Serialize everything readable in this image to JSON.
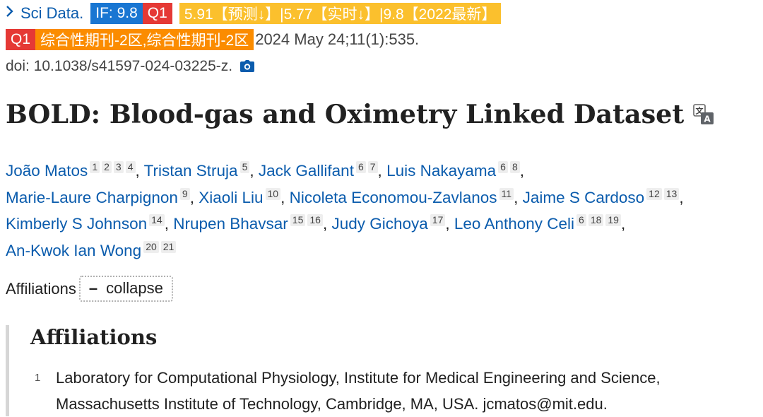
{
  "citation": {
    "journal": "Sci Data.",
    "if_badge": "IF: 9.8",
    "quartile": "Q1",
    "prediction": "5.91【预测↓】|5.77【实时↓】|9.8【2022最新】",
    "cas_quartile": "Q1",
    "category": "综合性期刊-2区,综合性期刊-2区",
    "pub_date": "2024 May 24;11(1):535.",
    "doi": "doi: 10.1038/s41597-024-03225-z."
  },
  "title": "BOLD: Blood-gas and Oximetry Linked Dataset",
  "authors": [
    {
      "name": "João Matos",
      "affs": [
        "1",
        "2",
        "3",
        "4"
      ]
    },
    {
      "name": "Tristan Struja",
      "affs": [
        "5"
      ]
    },
    {
      "name": "Jack Gallifant",
      "affs": [
        "6",
        "7"
      ]
    },
    {
      "name": "Luis Nakayama",
      "affs": [
        "6",
        "8"
      ]
    },
    {
      "name": "Marie-Laure Charpignon",
      "affs": [
        "9"
      ]
    },
    {
      "name": "Xiaoli Liu",
      "affs": [
        "10"
      ]
    },
    {
      "name": "Nicoleta Economou-Zavlanos",
      "affs": [
        "11"
      ]
    },
    {
      "name": "Jaime S Cardoso",
      "affs": [
        "12",
        "13"
      ]
    },
    {
      "name": "Kimberly S Johnson",
      "affs": [
        "14"
      ]
    },
    {
      "name": "Nrupen Bhavsar",
      "affs": [
        "15",
        "16"
      ]
    },
    {
      "name": "Judy Gichoya",
      "affs": [
        "17"
      ]
    },
    {
      "name": "Leo Anthony Celi",
      "affs": [
        "6",
        "18",
        "19"
      ]
    },
    {
      "name": "An-Kwok Ian Wong",
      "affs": [
        "20",
        "21"
      ]
    }
  ],
  "affiliations_toggle": {
    "label": "Affiliations",
    "button": "collapse"
  },
  "affiliations_panel": {
    "heading": "Affiliations",
    "items": [
      {
        "num": "1",
        "line1": "Laboratory for Computational Physiology, Institute for Medical Engineering and Science,",
        "line2": "Massachusetts Institute of Technology, Cambridge, MA, USA. jcmatos@mit.edu."
      }
    ]
  },
  "colors": {
    "link": "#0b5cad",
    "if_badge": "#1976d2",
    "q1_badge": "#e53935",
    "prediction_badge": "#fbc02d",
    "category_badge": "#fb8c00"
  },
  "icons": [
    "chevron-right-icon",
    "camera-icon",
    "translate-icon"
  ]
}
